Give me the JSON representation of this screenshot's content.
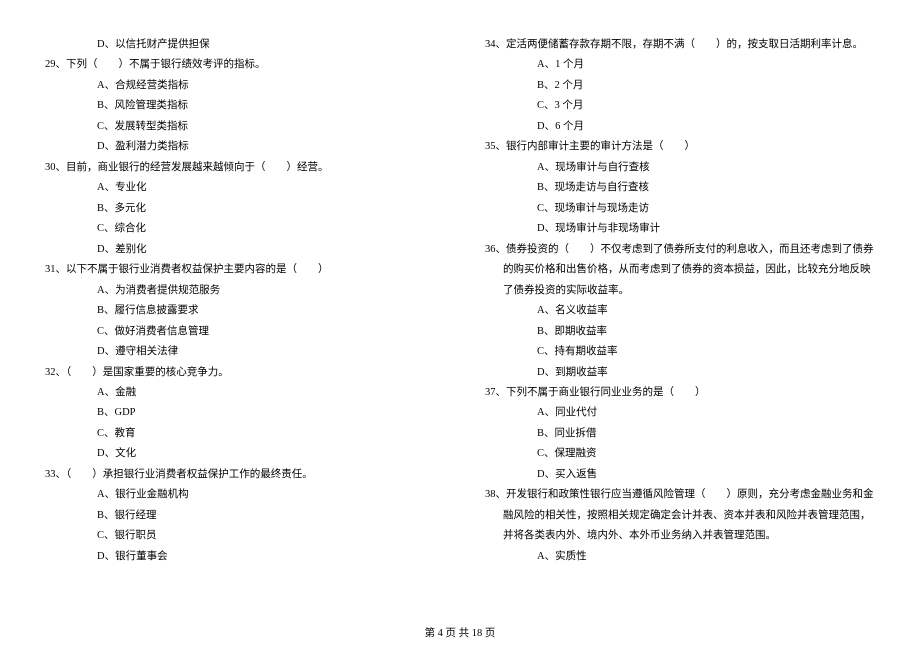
{
  "left_column": {
    "orphan_option": "D、以信托财产提供担保",
    "q29": {
      "stem": "29、下列（　　）不属于银行绩效考评的指标。",
      "options": {
        "a": "A、合规经营类指标",
        "b": "B、风险管理类指标",
        "c": "C、发展转型类指标",
        "d": "D、盈利潜力类指标"
      }
    },
    "q30": {
      "stem": "30、目前，商业银行的经营发展越来越倾向于（　　）经营。",
      "options": {
        "a": "A、专业化",
        "b": "B、多元化",
        "c": "C、综合化",
        "d": "D、差别化"
      }
    },
    "q31": {
      "stem": "31、以下不属于银行业消费者权益保护主要内容的是（　　）",
      "options": {
        "a": "A、为消费者提供规范服务",
        "b": "B、履行信息披露要求",
        "c": "C、做好消费者信息管理",
        "d": "D、遵守相关法律"
      }
    },
    "q32": {
      "stem": "32、（　　）是国家重要的核心竞争力。",
      "options": {
        "a": "A、金融",
        "b": "B、GDP",
        "c": "C、教育",
        "d": "D、文化"
      }
    },
    "q33": {
      "stem": "33、（　　）承担银行业消费者权益保护工作的最终责任。",
      "options": {
        "a": "A、银行业金融机构",
        "b": "B、银行经理",
        "c": "C、银行职员",
        "d": "D、银行董事会"
      }
    }
  },
  "right_column": {
    "q34": {
      "stem": "34、定活两便储蓄存款存期不限，存期不满（　　）的，按支取日活期利率计息。",
      "options": {
        "a": "A、1 个月",
        "b": "B、2 个月",
        "c": "C、3 个月",
        "d": "D、6 个月"
      }
    },
    "q35": {
      "stem": "35、银行内部审计主要的审计方法是（　　）",
      "options": {
        "a": "A、现场审计与自行查核",
        "b": "B、现场走访与自行查核",
        "c": "C、现场审计与现场走访",
        "d": "D、现场审计与非现场审计"
      }
    },
    "q36": {
      "stem": "36、债券投资的（　　）不仅考虑到了债券所支付的利息收入，而且还考虑到了债券的购买价格和出售价格，从而考虑到了债券的资本损益，因此，比较充分地反映了债券投资的实际收益率。",
      "options": {
        "a": "A、名义收益率",
        "b": "B、即期收益率",
        "c": "C、持有期收益率",
        "d": "D、到期收益率"
      }
    },
    "q37": {
      "stem": "37、下列不属于商业银行同业业务的是（　　）",
      "options": {
        "a": "A、同业代付",
        "b": "B、同业拆借",
        "c": "C、保理融资",
        "d": "D、买入返售"
      }
    },
    "q38": {
      "stem": "38、开发银行和政策性银行应当遵循风险管理（　　）原则，充分考虑金融业务和金融风险的相关性，按照相关规定确定会计并表、资本并表和风险并表管理范围，并将各类表内外、境内外、本外币业务纳入并表管理范围。",
      "options": {
        "a": "A、实质性"
      }
    }
  },
  "footer": "第 4 页 共 18 页"
}
